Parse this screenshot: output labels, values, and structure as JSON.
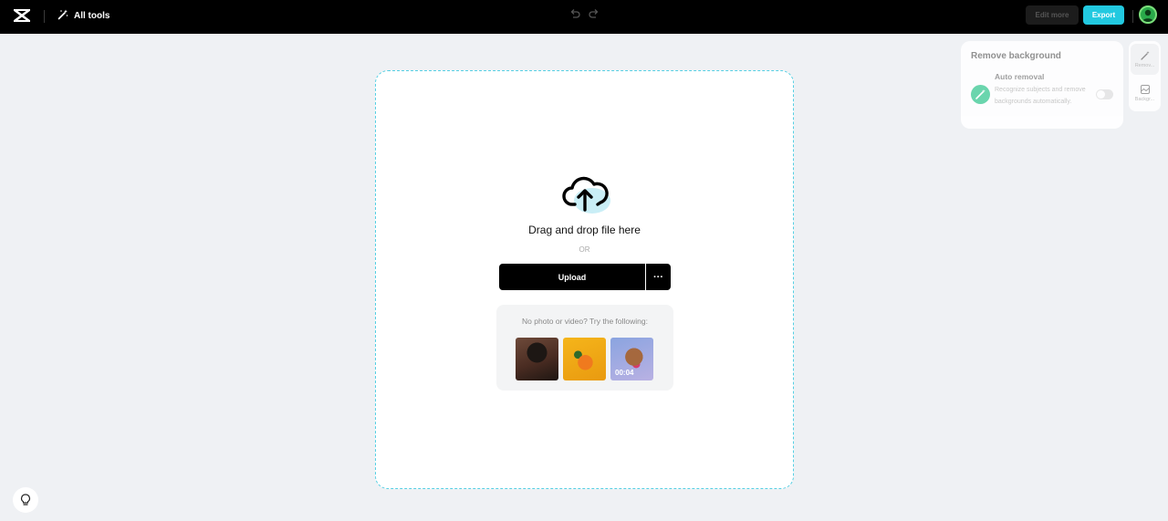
{
  "header": {
    "logo_icon": "capcut-logo-icon",
    "all_tools_label": "All tools",
    "all_tools_icon": "magic-wand-icon",
    "undo_icon": "undo-icon",
    "redo_icon": "redo-icon",
    "edit_more_label": "Edit more",
    "export_label": "Export",
    "avatar_icon": "user-avatar-icon"
  },
  "upload_area": {
    "icon": "cloud-upload-icon",
    "drag_text": "Drag and drop file here",
    "or_text": "OR",
    "upload_label": "Upload",
    "more_label": "···",
    "samples_label": "No photo or video? Try the following:",
    "samples": [
      {
        "kind": "photo",
        "subject": "person",
        "duration": ""
      },
      {
        "kind": "photo",
        "subject": "oranges",
        "duration": ""
      },
      {
        "kind": "video",
        "subject": "dog",
        "duration": "00:04"
      }
    ]
  },
  "right_panel": {
    "title": "Remove background",
    "auto_removal": {
      "title": "Auto removal",
      "description": "Recognize subjects and remove backgrounds automatically.",
      "enabled": false,
      "icon": "eraser-icon"
    },
    "side_tabs": [
      {
        "label": "Remov...",
        "icon": "remove-bg-icon"
      },
      {
        "label": "Backgr...",
        "icon": "background-icon"
      }
    ]
  },
  "help_icon": "lightbulb-icon",
  "colors": {
    "accent": "#22c9e0",
    "topbar": "#000000",
    "page_bg": "#eff1f4",
    "dropzone_border": "#55cfe3"
  }
}
